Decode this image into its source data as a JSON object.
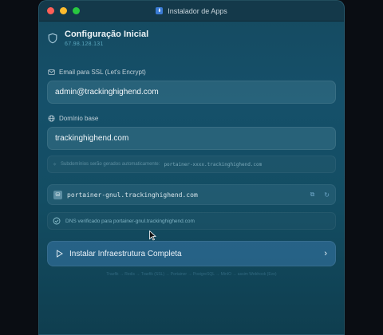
{
  "window": {
    "title": "Instalador de Apps"
  },
  "header": {
    "title": "Configuração Inicial",
    "subtitle": "67.98.128.131"
  },
  "email": {
    "label": "Email para SSL (Let's Encrypt)",
    "value": "admin@trackinghighend.com"
  },
  "domain": {
    "label": "Domínio base",
    "value": "trackinghighend.com"
  },
  "subdomain_hint": {
    "text": "Subdomínios serão gerados automaticamente:",
    "example": "portainer-xxxx.trackinghighend.com"
  },
  "generated_url": {
    "value": "portainer-gnul.trackinghighend.com",
    "icon": "portainer-icon"
  },
  "dns_status": {
    "text": "DNS verificado para portainer-gnul.trackinghighend.com",
    "status": "ok"
  },
  "install_button": {
    "label": "Instalar Infraestrutura Completa"
  },
  "footer": {
    "text": "Traefik → Redis → Traefik (SSL) → Portainer → PostgreSQL → MinIO → assim Webhook (Evo)"
  },
  "colors": {
    "accent": "#3878aa",
    "success": "#5fbf9a"
  }
}
